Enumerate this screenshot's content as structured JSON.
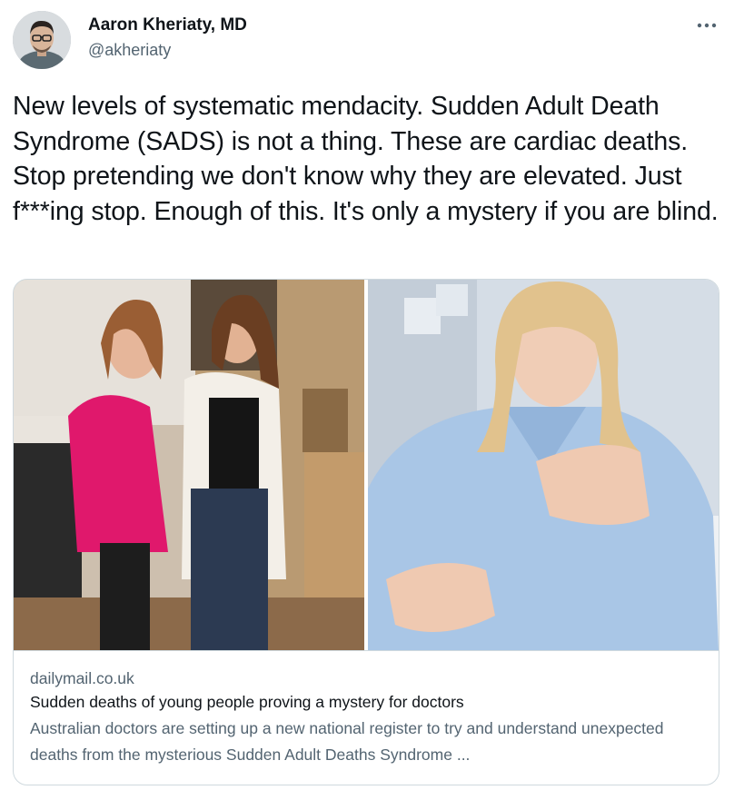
{
  "tweet": {
    "author": {
      "name": "Aaron Kheriaty, MD",
      "handle": "@akheriaty",
      "avatar_icon": "profile-photo"
    },
    "more_icon": "more-horizontal-icon",
    "text": "New levels of systematic mendacity. Sudden Adult Death Syndrome (SADS) is not a thing. These are cardiac deaths. Stop pretending we don't know why they are elevated. Just f***ing stop. Enough of this. It's only a mystery if you are blind."
  },
  "link_card": {
    "domain": "dailymail.co.uk",
    "title": "Sudden deaths of young people proving a mystery for doctors",
    "description": "Australian doctors are setting up a new national register to try and understand unexpected deaths from the mysterious Sudden Adult Deaths Syndrome ..."
  },
  "colors": {
    "text_primary": "#0f1419",
    "text_secondary": "#536471",
    "border": "#cfd9de"
  }
}
